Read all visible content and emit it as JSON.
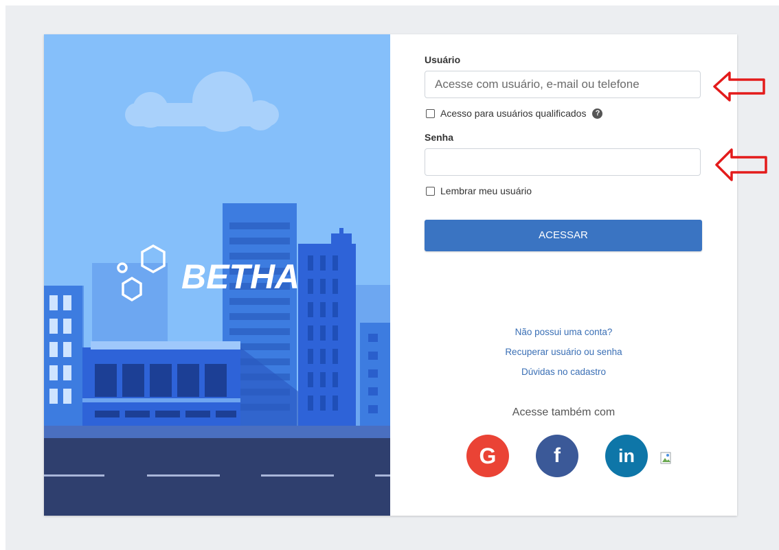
{
  "illustration": {
    "brand_text": "BETHA"
  },
  "form": {
    "user_label": "Usuário",
    "user_placeholder": "Acesse com usuário, e-mail ou telefone",
    "user_value": "",
    "qualified_label": "Acesso para usuários qualificados",
    "qualified_checked": false,
    "help_icon_text": "?",
    "password_label": "Senha",
    "password_value": "",
    "remember_label": "Lembrar meu usuário",
    "remember_checked": false,
    "submit_label": "ACESSAR"
  },
  "links": {
    "no_account": "Não possui uma conta?",
    "recover": "Recuperar usuário ou senha",
    "signup_help": "Dúvidas no cadastro"
  },
  "social": {
    "title": "Acesse também com",
    "items": [
      {
        "name": "google",
        "glyph": "G",
        "color": "#ea4335"
      },
      {
        "name": "facebook",
        "glyph": "f",
        "color": "#3b5998"
      },
      {
        "name": "linkedin",
        "glyph": "in",
        "color": "#0e76a8"
      }
    ]
  },
  "colors": {
    "sky": "#85bffa",
    "road": "#2f3f6e",
    "accent_button": "#3a74c2",
    "annotation_arrow": "#e31b1b"
  }
}
